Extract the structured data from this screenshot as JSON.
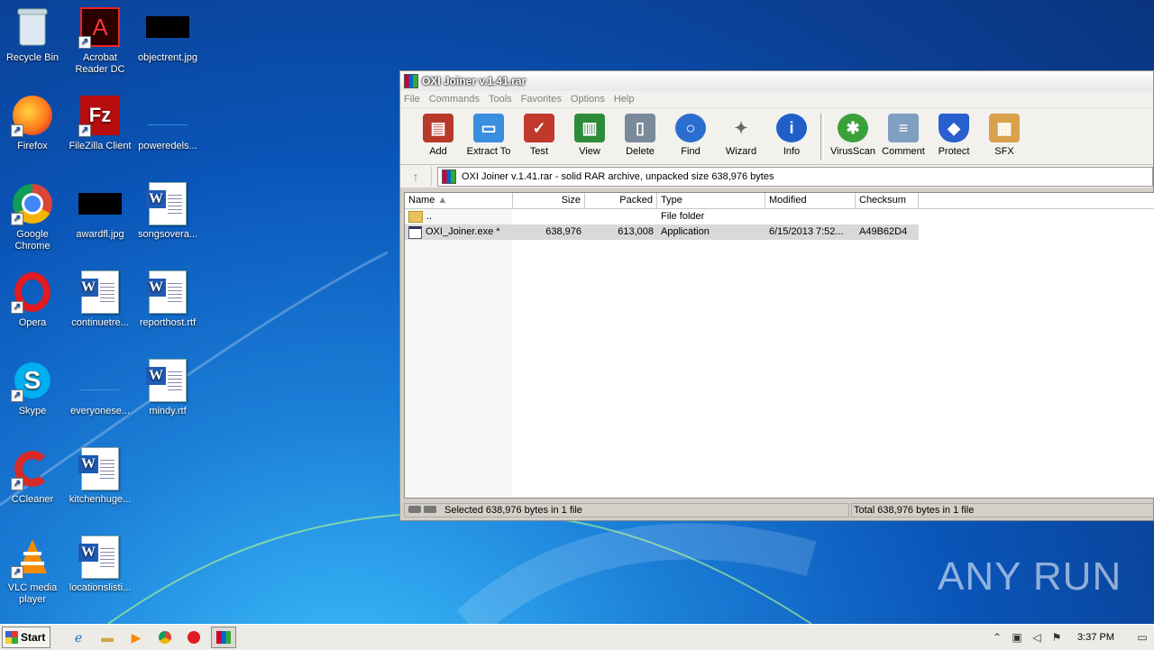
{
  "desktop": {
    "icons": [
      {
        "label": "Recycle Bin"
      },
      {
        "label": "Acrobat Reader DC"
      },
      {
        "label": "objectrent.jpg"
      },
      {
        "label": "Firefox"
      },
      {
        "label": "FileZilla Client"
      },
      {
        "label": "poweredels..."
      },
      {
        "label": "Google Chrome"
      },
      {
        "label": "awardfl.jpg"
      },
      {
        "label": "songsovera..."
      },
      {
        "label": "Opera"
      },
      {
        "label": "continuetre..."
      },
      {
        "label": "reporthost.rtf"
      },
      {
        "label": "Skype"
      },
      {
        "label": "everyonese..."
      },
      {
        "label": "mindy.rtf"
      },
      {
        "label": "CCleaner"
      },
      {
        "label": "kitchenhuge..."
      },
      {
        "label": "VLC media player"
      },
      {
        "label": "locationslisti..."
      }
    ]
  },
  "window": {
    "title": "OXI Joiner v.1.41.rar",
    "menu": [
      "File",
      "Commands",
      "Tools",
      "Favorites",
      "Options",
      "Help"
    ],
    "toolbar": [
      {
        "label": "Add",
        "icon": "add-archive-icon",
        "color": "#b83a2a"
      },
      {
        "label": "Extract To",
        "icon": "extract-folder-icon",
        "color": "#3a8ee0"
      },
      {
        "label": "Test",
        "icon": "test-clipboard-icon",
        "color": "#c0392b"
      },
      {
        "label": "View",
        "icon": "view-book-icon",
        "color": "#2e8b3a"
      },
      {
        "label": "Delete",
        "icon": "trash-icon",
        "color": "#7a8a99"
      },
      {
        "label": "Find",
        "icon": "magnifier-icon",
        "color": "#2a6fd0"
      },
      {
        "label": "Wizard",
        "icon": "wand-icon",
        "color": "#8a8a8a"
      },
      {
        "label": "Info",
        "icon": "info-icon",
        "color": "#1f5fc8"
      },
      {
        "label": "VirusScan",
        "icon": "bug-icon",
        "color": "#3aa03a"
      },
      {
        "label": "Comment",
        "icon": "comment-icon",
        "color": "#7f9fc0"
      },
      {
        "label": "Protect",
        "icon": "shield-icon",
        "color": "#2a5fd0"
      },
      {
        "label": "SFX",
        "icon": "sfx-box-icon",
        "color": "#d9a24a"
      }
    ],
    "address": "OXI Joiner v.1.41.rar - solid RAR archive, unpacked size 638,976 bytes",
    "columns": {
      "name": "Name",
      "size": "Size",
      "packed": "Packed",
      "type": "Type",
      "modified": "Modified",
      "checksum": "Checksum"
    },
    "rows": [
      {
        "name": "..",
        "size": "",
        "packed": "",
        "type": "File folder",
        "modified": "",
        "checksum": "",
        "icon": "folder-icon"
      },
      {
        "name": "OXI_Joiner.exe *",
        "size": "638,976",
        "packed": "613,008",
        "type": "Application",
        "modified": "6/15/2013 7:52...",
        "checksum": "A49B62D4",
        "icon": "exe-icon"
      }
    ],
    "status_left": "Selected 638,976 bytes in 1 file",
    "status_right": "Total 638,976 bytes in 1 file"
  },
  "taskbar": {
    "start_label": "Start",
    "clock": "3:37 PM"
  },
  "watermark": "ANY RUN"
}
